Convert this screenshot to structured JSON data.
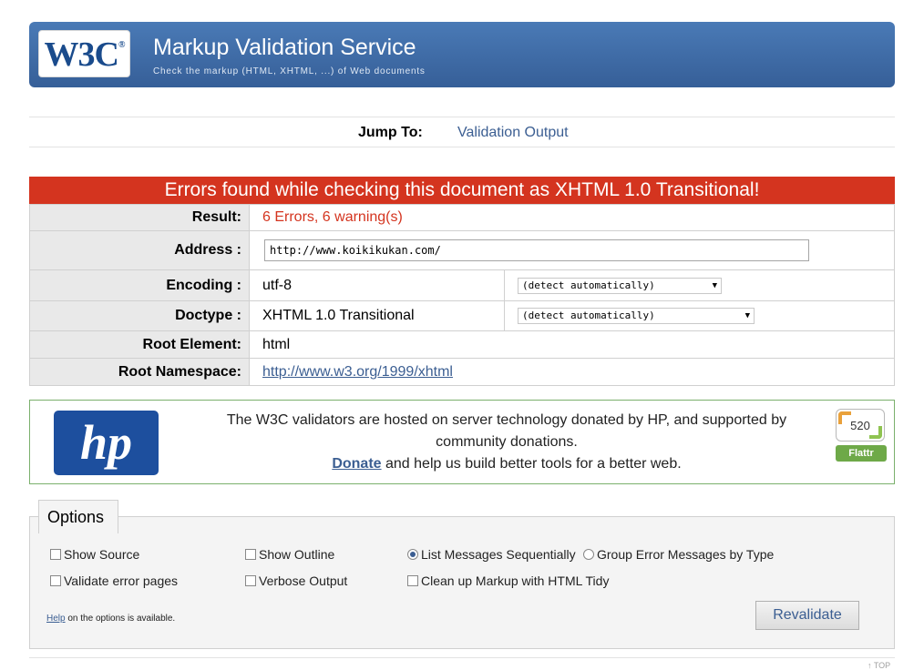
{
  "banner": {
    "logo_text": "W3C",
    "logo_mark": "®",
    "title": "Markup Validation Service",
    "subtitle": "Check the markup (HTML, XHTML, ...) of Web documents"
  },
  "jump": {
    "label": "Jump To:",
    "link": "Validation Output"
  },
  "error_header": "Errors found while checking this document as XHTML 1.0 Transitional!",
  "results": {
    "result_label": "Result:",
    "result_value": "6 Errors, 6 warning(s)",
    "address_label": "Address :",
    "address_value": "http://www.koikikukan.com/",
    "encoding_label": "Encoding :",
    "encoding_value": "utf-8",
    "encoding_select": "(detect automatically)",
    "doctype_label": "Doctype :",
    "doctype_value": "XHTML 1.0 Transitional",
    "doctype_select": "(detect automatically)",
    "root_element_label": "Root Element:",
    "root_element_value": "html",
    "root_ns_label": "Root Namespace:",
    "root_ns_value": "http://www.w3.org/1999/xhtml"
  },
  "hp": {
    "logo_text": "hp",
    "text_line1": "The W3C validators are hosted on server technology donated by HP, and supported by community donations.",
    "donate_link": "Donate",
    "text_line2": " and help us build better tools for a better web.",
    "flattr_count": "520",
    "flattr_label": "Flattr"
  },
  "options": {
    "legend": "Options",
    "show_source": "Show Source",
    "show_outline": "Show Outline",
    "list_sequential": "List Messages Sequentially",
    "group_errors": "Group Error Messages by Type",
    "validate_error_pages": "Validate error pages",
    "verbose_output": "Verbose Output",
    "clean_up": "Clean up Markup with HTML Tidy",
    "help_link": "Help",
    "help_text": " on the options is available.",
    "revalidate": "Revalidate"
  },
  "footer": {
    "top_link": "↑ TOP"
  }
}
